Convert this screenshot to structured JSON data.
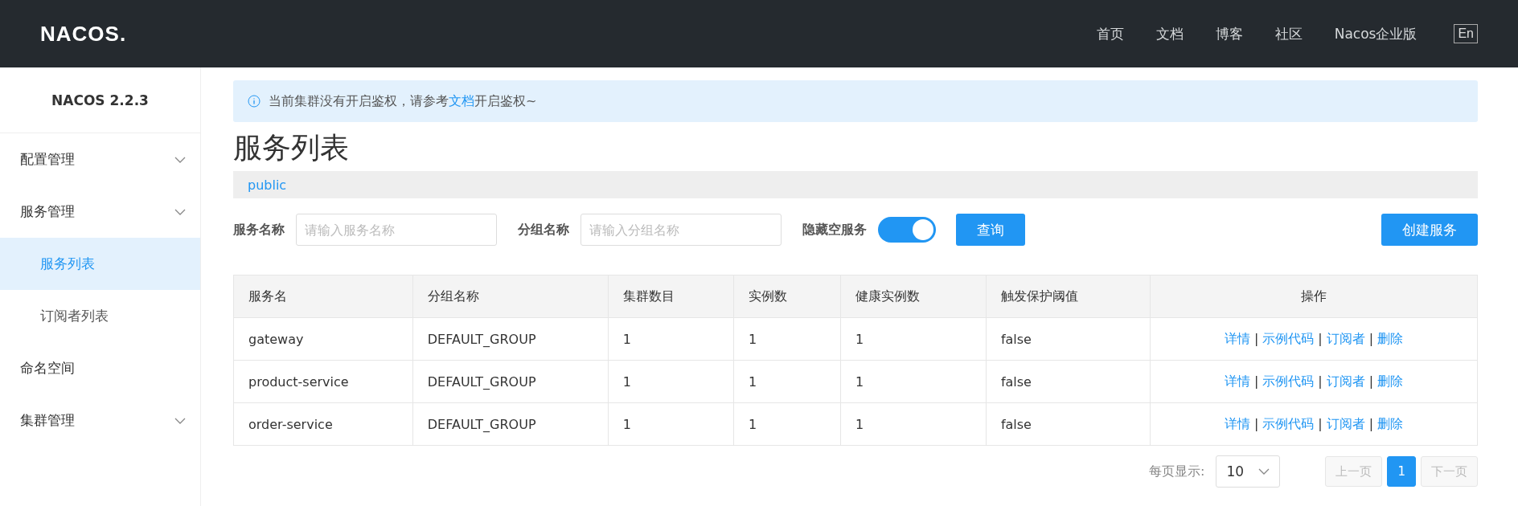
{
  "header": {
    "logo": "NACOS.",
    "nav": [
      {
        "label": "首页"
      },
      {
        "label": "文档"
      },
      {
        "label": "博客"
      },
      {
        "label": "社区"
      },
      {
        "label": "Nacos企业版"
      }
    ],
    "lang_button": "En"
  },
  "sidebar": {
    "title": "NACOS 2.2.3",
    "items": [
      {
        "label": "配置管理",
        "kind": "group",
        "selected": false
      },
      {
        "label": "服务管理",
        "kind": "group",
        "selected": false,
        "children": [
          {
            "label": "服务列表",
            "selected": true
          },
          {
            "label": "订阅者列表",
            "selected": false
          }
        ]
      },
      {
        "label": "命名空间",
        "kind": "link",
        "selected": false
      },
      {
        "label": "集群管理",
        "kind": "group",
        "selected": false
      }
    ]
  },
  "notice": {
    "before": "当前集群没有开启鉴权，请参考",
    "link": "文档",
    "after": "开启鉴权~"
  },
  "page_title": "服务列表",
  "namespace": "public",
  "filters": {
    "service_label": "服务名称",
    "service_placeholder": "请输入服务名称",
    "group_label": "分组名称",
    "group_placeholder": "请输入分组名称",
    "hide_empty_label": "隐藏空服务",
    "hide_empty_on": true,
    "query_button": "查询",
    "create_button": "创建服务"
  },
  "table": {
    "action_separator": "|",
    "columns": [
      "服务名",
      "分组名称",
      "集群数目",
      "实例数",
      "健康实例数",
      "触发保护阈值",
      "操作"
    ],
    "rows": [
      {
        "cells": [
          "gateway",
          "DEFAULT_GROUP",
          "1",
          "1",
          "1",
          "false"
        ],
        "actions": [
          "详情",
          "示例代码",
          "订阅者",
          "删除"
        ]
      },
      {
        "cells": [
          "product-service",
          "DEFAULT_GROUP",
          "1",
          "1",
          "1",
          "false"
        ],
        "actions": [
          "详情",
          "示例代码",
          "订阅者",
          "删除"
        ]
      },
      {
        "cells": [
          "order-service",
          "DEFAULT_GROUP",
          "1",
          "1",
          "1",
          "false"
        ],
        "actions": [
          "详情",
          "示例代码",
          "订阅者",
          "删除"
        ]
      }
    ]
  },
  "pagination": {
    "page_size_label": "每页显示:",
    "page_size": "10",
    "prev": "上一页",
    "next": "下一页",
    "pages": [
      {
        "label": "1",
        "selected": true
      }
    ]
  }
}
